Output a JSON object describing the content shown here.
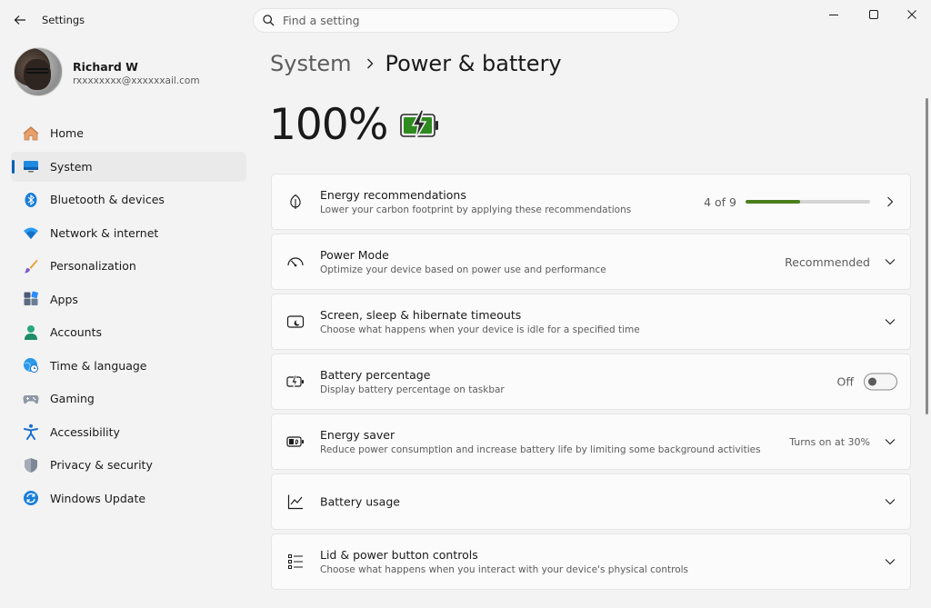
{
  "window": {
    "app_title": "Settings",
    "search_placeholder": "Find a setting"
  },
  "profile": {
    "name": "Richard W",
    "email": "rxxxxxxxx@xxxxxxail.com"
  },
  "sidebar": {
    "items": [
      {
        "label": "Home",
        "icon": "home-icon"
      },
      {
        "label": "System",
        "icon": "monitor-icon",
        "selected": true
      },
      {
        "label": "Bluetooth & devices",
        "icon": "bluetooth-icon"
      },
      {
        "label": "Network & internet",
        "icon": "wifi-icon"
      },
      {
        "label": "Personalization",
        "icon": "brush-icon"
      },
      {
        "label": "Apps",
        "icon": "apps-icon"
      },
      {
        "label": "Accounts",
        "icon": "person-icon"
      },
      {
        "label": "Time & language",
        "icon": "globe-clock-icon"
      },
      {
        "label": "Gaming",
        "icon": "gamepad-icon"
      },
      {
        "label": "Accessibility",
        "icon": "accessibility-icon"
      },
      {
        "label": "Privacy & security",
        "icon": "shield-icon"
      },
      {
        "label": "Windows Update",
        "icon": "update-icon"
      }
    ]
  },
  "breadcrumb": {
    "parent": "System",
    "current": "Power & battery"
  },
  "battery": {
    "percent_text": "100%",
    "level": 1.0,
    "charging": true
  },
  "cards": [
    {
      "title": "Energy recommendations",
      "desc": "Lower your carbon footprint by applying these recommendations",
      "value": "4 of 9",
      "progress": 0.44
    },
    {
      "title": "Power Mode",
      "desc": "Optimize your device based on power use and performance",
      "value": "Recommended"
    },
    {
      "title": "Screen, sleep & hibernate timeouts",
      "desc": "Choose what happens when your device is idle for a specified time"
    },
    {
      "title": "Battery percentage",
      "desc": "Display battery percentage on taskbar",
      "value": "Off",
      "toggle_on": false
    },
    {
      "title": "Energy saver",
      "desc": "Reduce power consumption and increase battery life by limiting some background activities",
      "value": "Turns on at 30%"
    },
    {
      "title": "Battery usage"
    },
    {
      "title": "Lid & power button controls",
      "desc": "Choose what happens when you interact with your device's physical controls"
    }
  ],
  "colors": {
    "accent": "#005fb8",
    "battery_green": "#2e8b1f",
    "progress_green": "#4a7f1c"
  }
}
